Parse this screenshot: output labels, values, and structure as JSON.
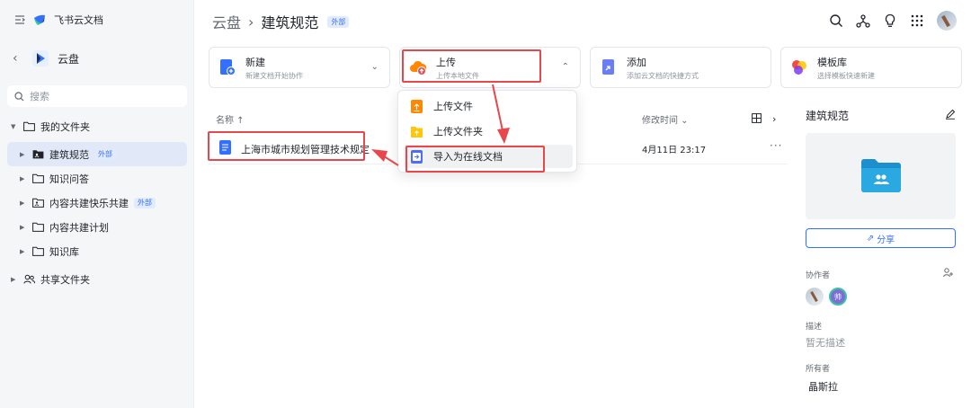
{
  "app": {
    "title": "飞书云文档"
  },
  "drive": {
    "title": "云盘"
  },
  "search": {
    "placeholder": "搜索"
  },
  "tree": {
    "my_folder": "我的文件夹",
    "items": [
      {
        "label": "建筑规范",
        "badge": "外部",
        "active": true
      },
      {
        "label": "知识问答"
      },
      {
        "label": "内容共建快乐共建",
        "badge": "外部"
      },
      {
        "label": "内容共建计划"
      },
      {
        "label": "知识库"
      }
    ],
    "shared_folder": "共享文件夹"
  },
  "breadcrumb": {
    "root": "云盘",
    "current": "建筑规范",
    "badge": "外部"
  },
  "actions": [
    {
      "title": "新建",
      "subtitle": "新建文档开始协作"
    },
    {
      "title": "上传",
      "subtitle": "上传本地文件"
    },
    {
      "title": "添加",
      "subtitle": "添加云文档的快捷方式"
    },
    {
      "title": "模板库",
      "subtitle": "选择模板快速新建"
    }
  ],
  "upload_menu": [
    "上传文件",
    "上传文件夹",
    "导入为在线文档"
  ],
  "table": {
    "col_name": "名称 ↑",
    "col_modified": "修改时间 ⌄",
    "rows": [
      {
        "name": "上海市城市规划管理技术规定",
        "modified": "4月11日 23:17",
        "more": "···"
      }
    ]
  },
  "panel": {
    "title": "建筑规范",
    "share_label": "分享",
    "collaborators_label": "协作者",
    "collab_b_initial": "帅",
    "description_label": "描述",
    "description_value": "暂无描述",
    "owner_label": "所有者",
    "owner_value": "晶斯拉"
  },
  "colors": {
    "accent": "#3370ff",
    "annotation": "#e8484b",
    "sidebar_bg": "#f5f6f7"
  }
}
